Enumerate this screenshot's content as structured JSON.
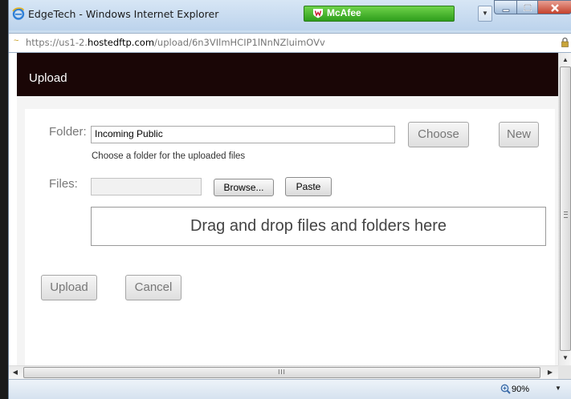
{
  "browser": {
    "window_title": "EdgeTech - Windows Internet Explorer",
    "toolbar_brand": "McAfee",
    "address_scheme": "https://",
    "address_sub": "us1-2.",
    "address_host": "hostedftp.com",
    "address_path": "/upload/6n3VIlmHCIP1lNnNZluimOVv",
    "zoom_level": "90%",
    "scroll_grip": "III"
  },
  "dialog": {
    "title": "Upload",
    "folder_label": "Folder:",
    "folder_value": "Incoming Public",
    "choose_button": "Choose",
    "new_button": "New",
    "folder_hint": "Choose a folder for the uploaded files",
    "files_label": "Files:",
    "browse_button": "Browse...",
    "paste_button": "Paste",
    "dropzone_text": "Drag and drop files and folders here",
    "upload_button": "Upload",
    "cancel_button": "Cancel"
  },
  "colors": {
    "header_bg": "#1a0606",
    "mcafee_green": "#2e9e1c",
    "close_red": "#c4412c"
  }
}
